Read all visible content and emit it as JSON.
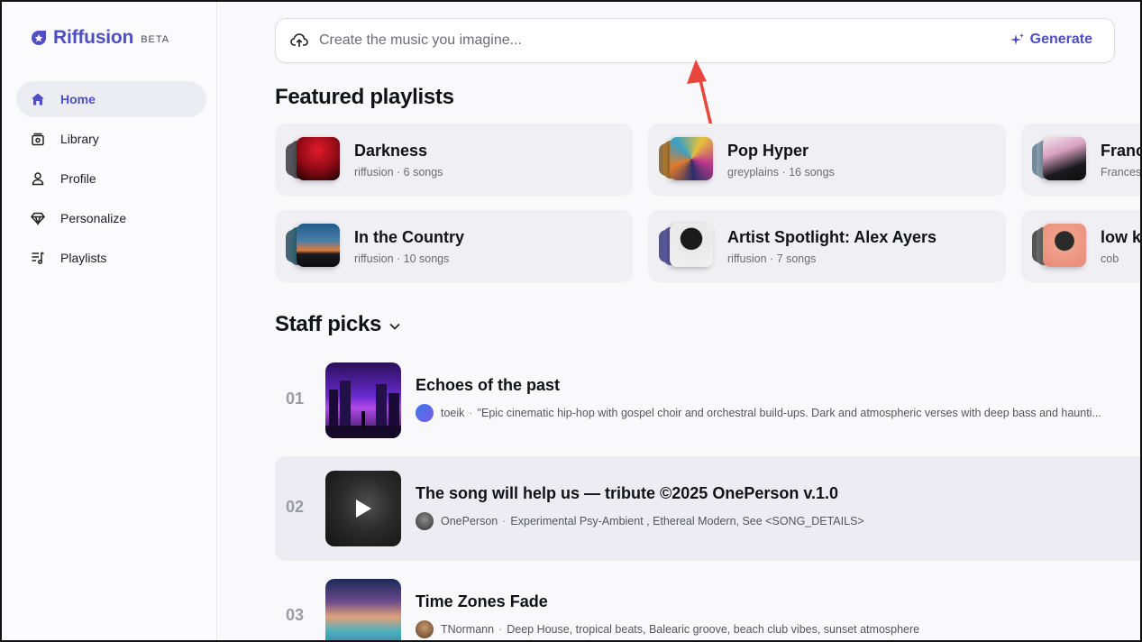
{
  "brand": {
    "name": "Riffusion",
    "badge": "BETA",
    "accent": "#4f4fc3"
  },
  "nav": {
    "items": [
      {
        "label": "Home",
        "icon": "home-icon",
        "active": true
      },
      {
        "label": "Library",
        "icon": "library-icon",
        "active": false
      },
      {
        "label": "Profile",
        "icon": "person-icon",
        "active": false
      },
      {
        "label": "Personalize",
        "icon": "diamond-icon",
        "active": false
      },
      {
        "label": "Playlists",
        "icon": "playlist-icon",
        "active": false
      }
    ]
  },
  "prompt": {
    "placeholder": "Create the music you imagine...",
    "icon": "cloud-upload-icon",
    "generate_label": "Generate",
    "generate_icon": "sparkle-icon"
  },
  "featured": {
    "title": "Featured playlists",
    "playlists": [
      {
        "title": "Darkness",
        "meta": "riffusion · 6 songs"
      },
      {
        "title": "Pop Hyper",
        "meta": "greyplains · 16 songs"
      },
      {
        "title": "Franc",
        "meta": "Frances"
      },
      {
        "title": "In the Country",
        "meta": "riffusion · 10 songs"
      },
      {
        "title": "Artist Spotlight: Alex Ayers",
        "meta": "riffusion · 7 songs"
      },
      {
        "title": "low k",
        "meta": "cob"
      }
    ]
  },
  "staff": {
    "title": "Staff picks",
    "tracks": [
      {
        "num": "01",
        "title": "Echoes of the past",
        "author": "toeik",
        "desc": "\"Epic cinematic hip-hop with gospel choir and orchestral build-ups. Dark and atmospheric verses with deep bass and haunti..."
      },
      {
        "num": "02",
        "title": "The song will help us — tribute ©2025 OnePerson v.1.0",
        "author": "OnePerson",
        "desc": "Experimental Psy-Ambient , Ethereal Modern, See <SONG_DETAILS>"
      },
      {
        "num": "03",
        "title": "Time Zones Fade",
        "author": "TNormann",
        "desc": "Deep House, tropical beats, Balearic groove, beach club vibes, sunset atmosphere"
      }
    ]
  },
  "colors": {
    "annotation_arrow": "#e8453c"
  }
}
